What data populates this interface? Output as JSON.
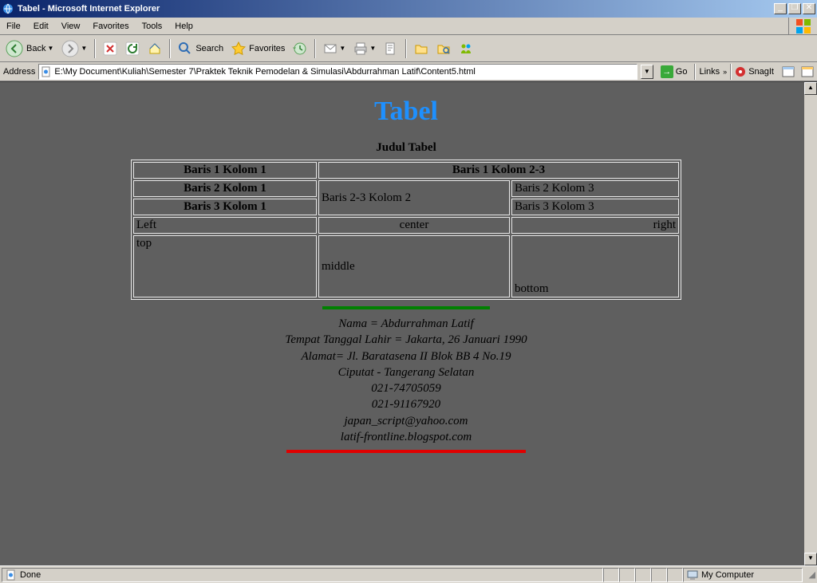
{
  "window": {
    "title": "Tabel - Microsoft Internet Explorer"
  },
  "menu": {
    "file": "File",
    "edit": "Edit",
    "view": "View",
    "favorites": "Favorites",
    "tools": "Tools",
    "help": "Help"
  },
  "toolbar": {
    "back": "Back",
    "search": "Search",
    "favorites": "Favorites"
  },
  "address": {
    "label": "Address",
    "value": "E:\\My Document\\Kuliah\\Semester 7\\Praktek Teknik Pemodelan & Simulasi\\Abdurrahman Latif\\Content5.html",
    "go": "Go",
    "links": "Links",
    "snagit": "SnagIt"
  },
  "page": {
    "heading": "Tabel",
    "caption": "Judul Tabel",
    "cells": {
      "r1c1": "Baris 1 Kolom 1",
      "r1c23": "Baris 1 Kolom 2-3",
      "r2c1": "Baris 2 Kolom 1",
      "r23c2": "Baris 2-3 Kolom 2",
      "r2c3": "Baris 2 Kolom 3",
      "r3c1": "Baris 3 Kolom 1",
      "r3c3": "Baris 3 Kolom 3",
      "left": "Left",
      "center": "center",
      "right": "right",
      "top": "top",
      "middle": "middle",
      "bottom": "bottom"
    },
    "info": {
      "nama": "Nama = Abdurrahman Latif",
      "ttl": "Tempat Tanggal Lahir = Jakarta, 26 Januari 1990",
      "alamat": "Alamat= Jl. Baratasena II Blok BB 4 No.19",
      "kota": "Ciputat - Tangerang Selatan",
      "telp1": "021-74705059",
      "telp2": "021-91167920",
      "email": "japan_script@yahoo.com",
      "blog": "latif-frontline.blogspot.com"
    }
  },
  "status": {
    "done": "Done",
    "zone": "My Computer"
  }
}
